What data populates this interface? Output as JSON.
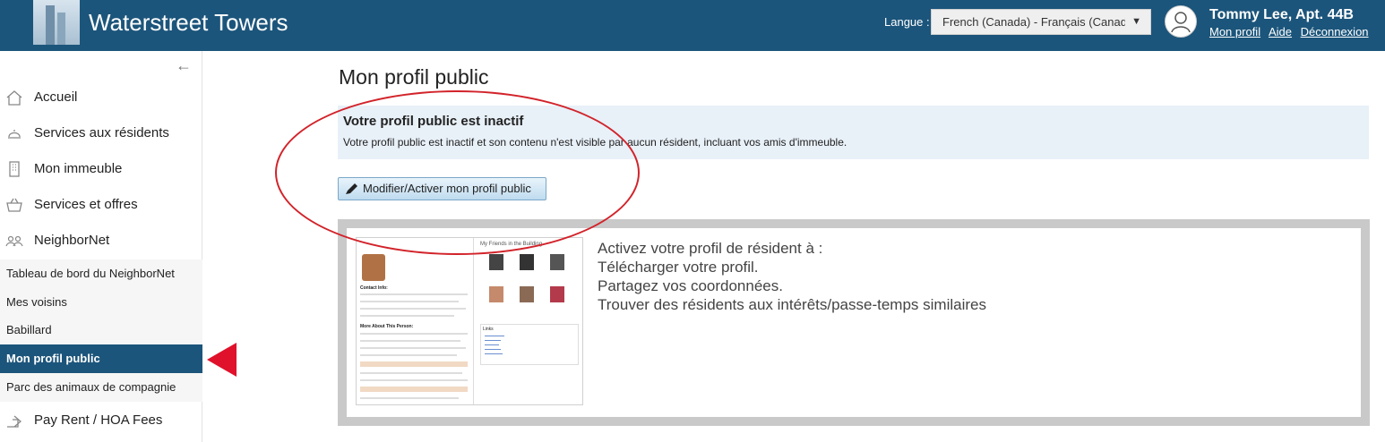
{
  "header": {
    "title": "Waterstreet Towers",
    "language_label": "Langue :",
    "language_value": "French (Canada) - Français (Canada)",
    "user_name": "Tommy Lee, Apt. 44B",
    "links": [
      "Mon profil",
      "Aide",
      "Déconnexion"
    ]
  },
  "sidebar": {
    "items": [
      {
        "label": "Accueil",
        "icon": "home-icon"
      },
      {
        "label": "Services aux résidents",
        "icon": "service-bell-icon"
      },
      {
        "label": "Mon immeuble",
        "icon": "building-icon"
      },
      {
        "label": "Services et offres",
        "icon": "basket-icon"
      },
      {
        "label": "NeighborNet",
        "icon": "people-icon"
      }
    ],
    "subitems": [
      {
        "label": "Tableau de bord du NeighborNet"
      },
      {
        "label": "Mes voisins"
      },
      {
        "label": "Babillard"
      },
      {
        "label": "Mon profil public",
        "active": true
      },
      {
        "label": "Parc des animaux de compagnie"
      }
    ],
    "bottom_item": {
      "label": "Pay Rent / HOA Fees",
      "icon": "payment-icon"
    }
  },
  "main": {
    "page_title": "Mon profil public",
    "notice": {
      "title": "Votre profil public est inactif",
      "text": "Votre profil public est inactif et son contenu n'est visible par aucun résident, incluant vos amis d'immeuble."
    },
    "edit_button": "Modifier/Activer mon profil public",
    "promo": {
      "thumb_friends_title": "My Friends in the Building",
      "thumb_links_title": "Links",
      "thumb_contact_title": "Contact Info:",
      "thumb_more_title": "More About This Person:",
      "lines": [
        "Activez votre profil de résident à :",
        "Télécharger votre profil.",
        "Partagez vos coordonnées.",
        "Trouver des résidents aux intérêts/passe-temps similaires"
      ]
    }
  },
  "colors": {
    "header_bg": "#1c557b",
    "active_bg": "#1c557b",
    "notice_bg": "#e8f0f8",
    "annotation_red": "#d2232a"
  }
}
